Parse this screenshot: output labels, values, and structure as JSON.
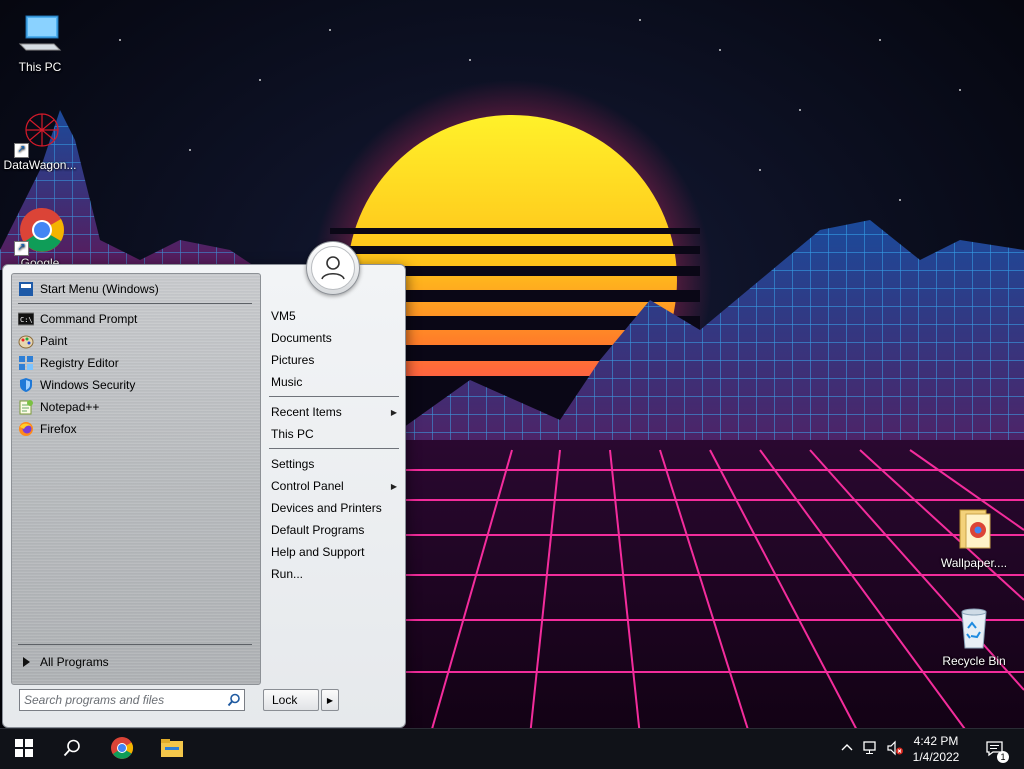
{
  "desktop": {
    "icons": [
      {
        "label": "This PC",
        "icon": "computer-icon"
      },
      {
        "label": "DataWagon...",
        "icon": "datawagon-icon"
      },
      {
        "label": "Google",
        "icon": "chrome-icon"
      },
      {
        "label": "Wallpaper....",
        "icon": "folder-chrome-icon"
      },
      {
        "label": "Recycle Bin",
        "icon": "recycle-bin-icon"
      }
    ]
  },
  "start_menu": {
    "header_item": {
      "label": "Start Menu (Windows)",
      "icon": "start-menu-icon"
    },
    "pinned": [
      {
        "label": "Command Prompt",
        "icon": "command-prompt-icon"
      },
      {
        "label": "Paint",
        "icon": "paint-icon"
      },
      {
        "label": "Registry Editor",
        "icon": "registry-editor-icon"
      },
      {
        "label": "Windows Security",
        "icon": "windows-security-icon"
      },
      {
        "label": "Notepad++",
        "icon": "notepad-plus-plus-icon"
      },
      {
        "label": "Firefox",
        "icon": "firefox-icon"
      }
    ],
    "all_programs": "All Programs",
    "right_items": [
      {
        "label": "VM5"
      },
      {
        "label": "Documents"
      },
      {
        "label": "Pictures"
      },
      {
        "label": "Music"
      },
      {
        "label": "Recent Items",
        "submenu": true
      },
      {
        "label": "This PC"
      },
      {
        "label": "Settings"
      },
      {
        "label": "Control Panel",
        "submenu": true
      },
      {
        "label": "Devices and Printers"
      },
      {
        "label": "Default Programs"
      },
      {
        "label": "Help and Support"
      },
      {
        "label": "Run..."
      }
    ],
    "search_placeholder": "Search programs and files",
    "lock_label": "Lock"
  },
  "taskbar": {
    "buttons": [
      {
        "icon": "windows-start-icon"
      },
      {
        "icon": "search-icon"
      },
      {
        "icon": "chrome-icon"
      },
      {
        "icon": "file-explorer-icon"
      }
    ],
    "tray": {
      "time": "4:42 PM",
      "date": "1/4/2022",
      "notification_count": "1"
    }
  },
  "colors": {
    "taskbar_bg": "#101218",
    "menu_left_bg": "#b9bcbf",
    "menu_right_bg": "#eceef0",
    "sun_top": "#ffe419",
    "sun_bottom": "#ff3a6b",
    "grid_pink": "#ff2fa3",
    "grid_cyan": "#38c8ff"
  }
}
